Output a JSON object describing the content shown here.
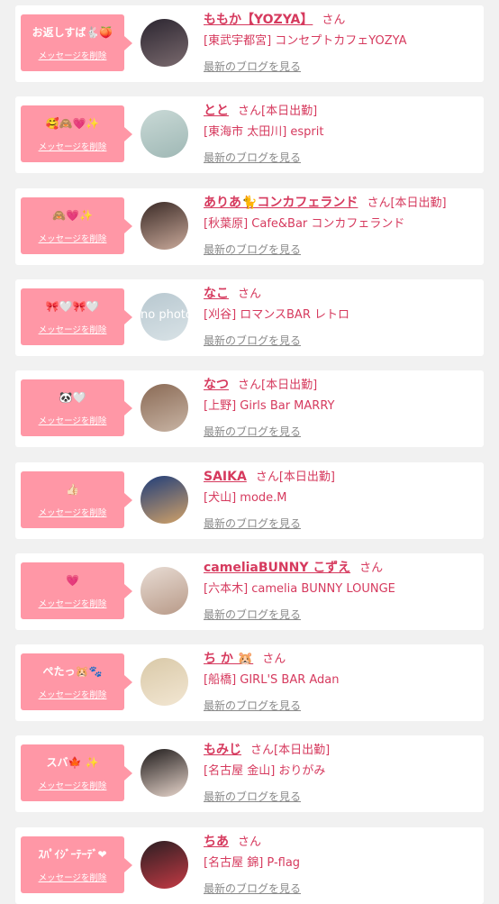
{
  "accent_color": "#ff97a6",
  "text_color": "#d63a5e",
  "delete_label": "メッセージを削除",
  "blog_label": "最新のブログを見る",
  "san_label": "さん",
  "no_photo_label": "no photo",
  "items": [
    {
      "message": "お返しすば🐇🍑",
      "name": "ももか【YOZYA】",
      "status": "",
      "shop": "[東武宇都宮] コンセプトカフェYOZYA",
      "avatar_colors": [
        "#2b2530",
        "#7a6a6e"
      ]
    },
    {
      "message": "🥰🙈💗✨",
      "name": "とと",
      "status": "[本日出勤]",
      "shop": "[東海市 太田川] esprit",
      "avatar_colors": [
        "#c9d9d6",
        "#9fb8b5"
      ]
    },
    {
      "message": "🙈💗✨",
      "name": "ありあ🐈コンカフェランド",
      "status": "[本日出勤]",
      "shop": "[秋葉原] Cafe&Bar コンカフェランド",
      "avatar_colors": [
        "#3a2a26",
        "#c9a99a"
      ]
    },
    {
      "message": "🎀🤍🎀🤍",
      "name": "なこ",
      "status": "",
      "shop": "[刈谷] ロマンスBAR レトロ",
      "avatar_colors": [
        "#b8c8d0",
        "#d8e2e6"
      ]
    },
    {
      "message": "🐼🤍",
      "name": "なつ",
      "status": "[本日出勤]",
      "shop": "[上野] Girls Bar MARRY",
      "avatar_colors": [
        "#8a6a55",
        "#c8b4a4"
      ]
    },
    {
      "message": "👍🏻",
      "name": "SAIKA",
      "status": "[本日出勤]",
      "shop": "[犬山] mode.M",
      "avatar_colors": [
        "#1f3d7a",
        "#d2a268"
      ]
    },
    {
      "message": "💗",
      "name": "cameliaBUNNY こずえ",
      "status": "",
      "shop": "[六本木] camelia BUNNY LOUNGE",
      "avatar_colors": [
        "#e8dcd4",
        "#b89a88"
      ]
    },
    {
      "message": "ぺたっ🐹🐾",
      "name": "ち か 🐹",
      "status": "",
      "shop": "[船橋] GIRL'S BAR Adan",
      "avatar_colors": [
        "#d9c9a8",
        "#f2e6d2"
      ]
    },
    {
      "message": "スバ🍁 ✨",
      "name": "もみじ",
      "status": "[本日出勤]",
      "shop": "[名古屋 金山] おりがみ",
      "avatar_colors": [
        "#1e1a1a",
        "#e8d6cc"
      ]
    },
    {
      "message": "ｽﾊﾟｲｼﾞｰﾃｰﾃﾞ❤",
      "name": "ちあ",
      "status": "",
      "shop": "[名古屋 錦] P-flag",
      "avatar_colors": [
        "#2a1e22",
        "#c43a44"
      ]
    }
  ]
}
